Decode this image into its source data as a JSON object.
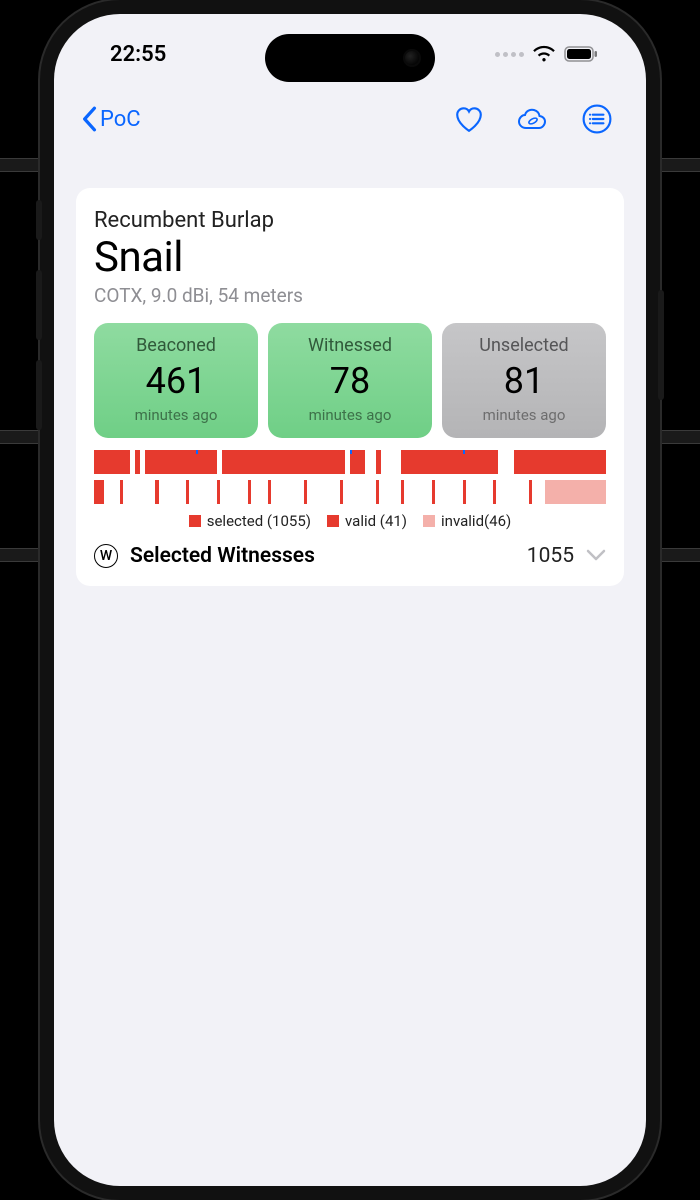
{
  "status": {
    "time": "22:55"
  },
  "nav": {
    "back_label": "PoC"
  },
  "card": {
    "supertitle": "Recumbent Burlap",
    "title": "Snail",
    "subtitle": "COTX, 9.0 dBi, 54 meters"
  },
  "tiles": [
    {
      "label": "Beaconed",
      "value": "461",
      "sub": "minutes ago",
      "kind": "green"
    },
    {
      "label": "Witnessed",
      "value": "78",
      "sub": "minutes ago",
      "kind": "green"
    },
    {
      "label": "Unselected",
      "value": "81",
      "sub": "minutes ago",
      "kind": "gray"
    }
  ],
  "legend": {
    "selected": {
      "label": "selected (1055)",
      "color": "#e63a2e"
    },
    "valid": {
      "label": "valid (41)",
      "color": "#e63a2e"
    },
    "invalid": {
      "label": "invalid(46)",
      "color": "#f4b0aa"
    }
  },
  "section": {
    "icon_letter": "W",
    "label": "Selected Witnesses",
    "count": "1055"
  },
  "chart_data": {
    "type": "bar",
    "title": "",
    "colors": {
      "selected": "#e63a2e",
      "valid": "#e63a2e",
      "invalid": "#f4b0aa"
    },
    "series": [
      {
        "name": "selected",
        "total": 1055,
        "segments": [
          [
            0,
            2
          ],
          [
            3,
            6
          ],
          [
            8,
            8
          ],
          [
            10,
            23
          ],
          [
            25,
            48
          ],
          [
            50,
            52
          ],
          [
            55,
            55
          ],
          [
            60,
            78
          ],
          [
            82,
            100
          ]
        ],
        "ticks": [
          20,
          50,
          72
        ]
      },
      {
        "name": "valid_invalid",
        "valid_total": 41,
        "invalid_total": 46,
        "segments_valid": [
          [
            0,
            2
          ],
          [
            5,
            5
          ],
          [
            12,
            12
          ],
          [
            18,
            18
          ],
          [
            24,
            24
          ],
          [
            30,
            30
          ],
          [
            34,
            34
          ],
          [
            41,
            41
          ],
          [
            48,
            48
          ],
          [
            55,
            55
          ],
          [
            60,
            60
          ],
          [
            66,
            66
          ],
          [
            72,
            72
          ],
          [
            78,
            78
          ],
          [
            85,
            85
          ],
          [
            90,
            90
          ]
        ],
        "segments_invalid": [
          [
            88,
            100
          ]
        ]
      }
    ]
  }
}
